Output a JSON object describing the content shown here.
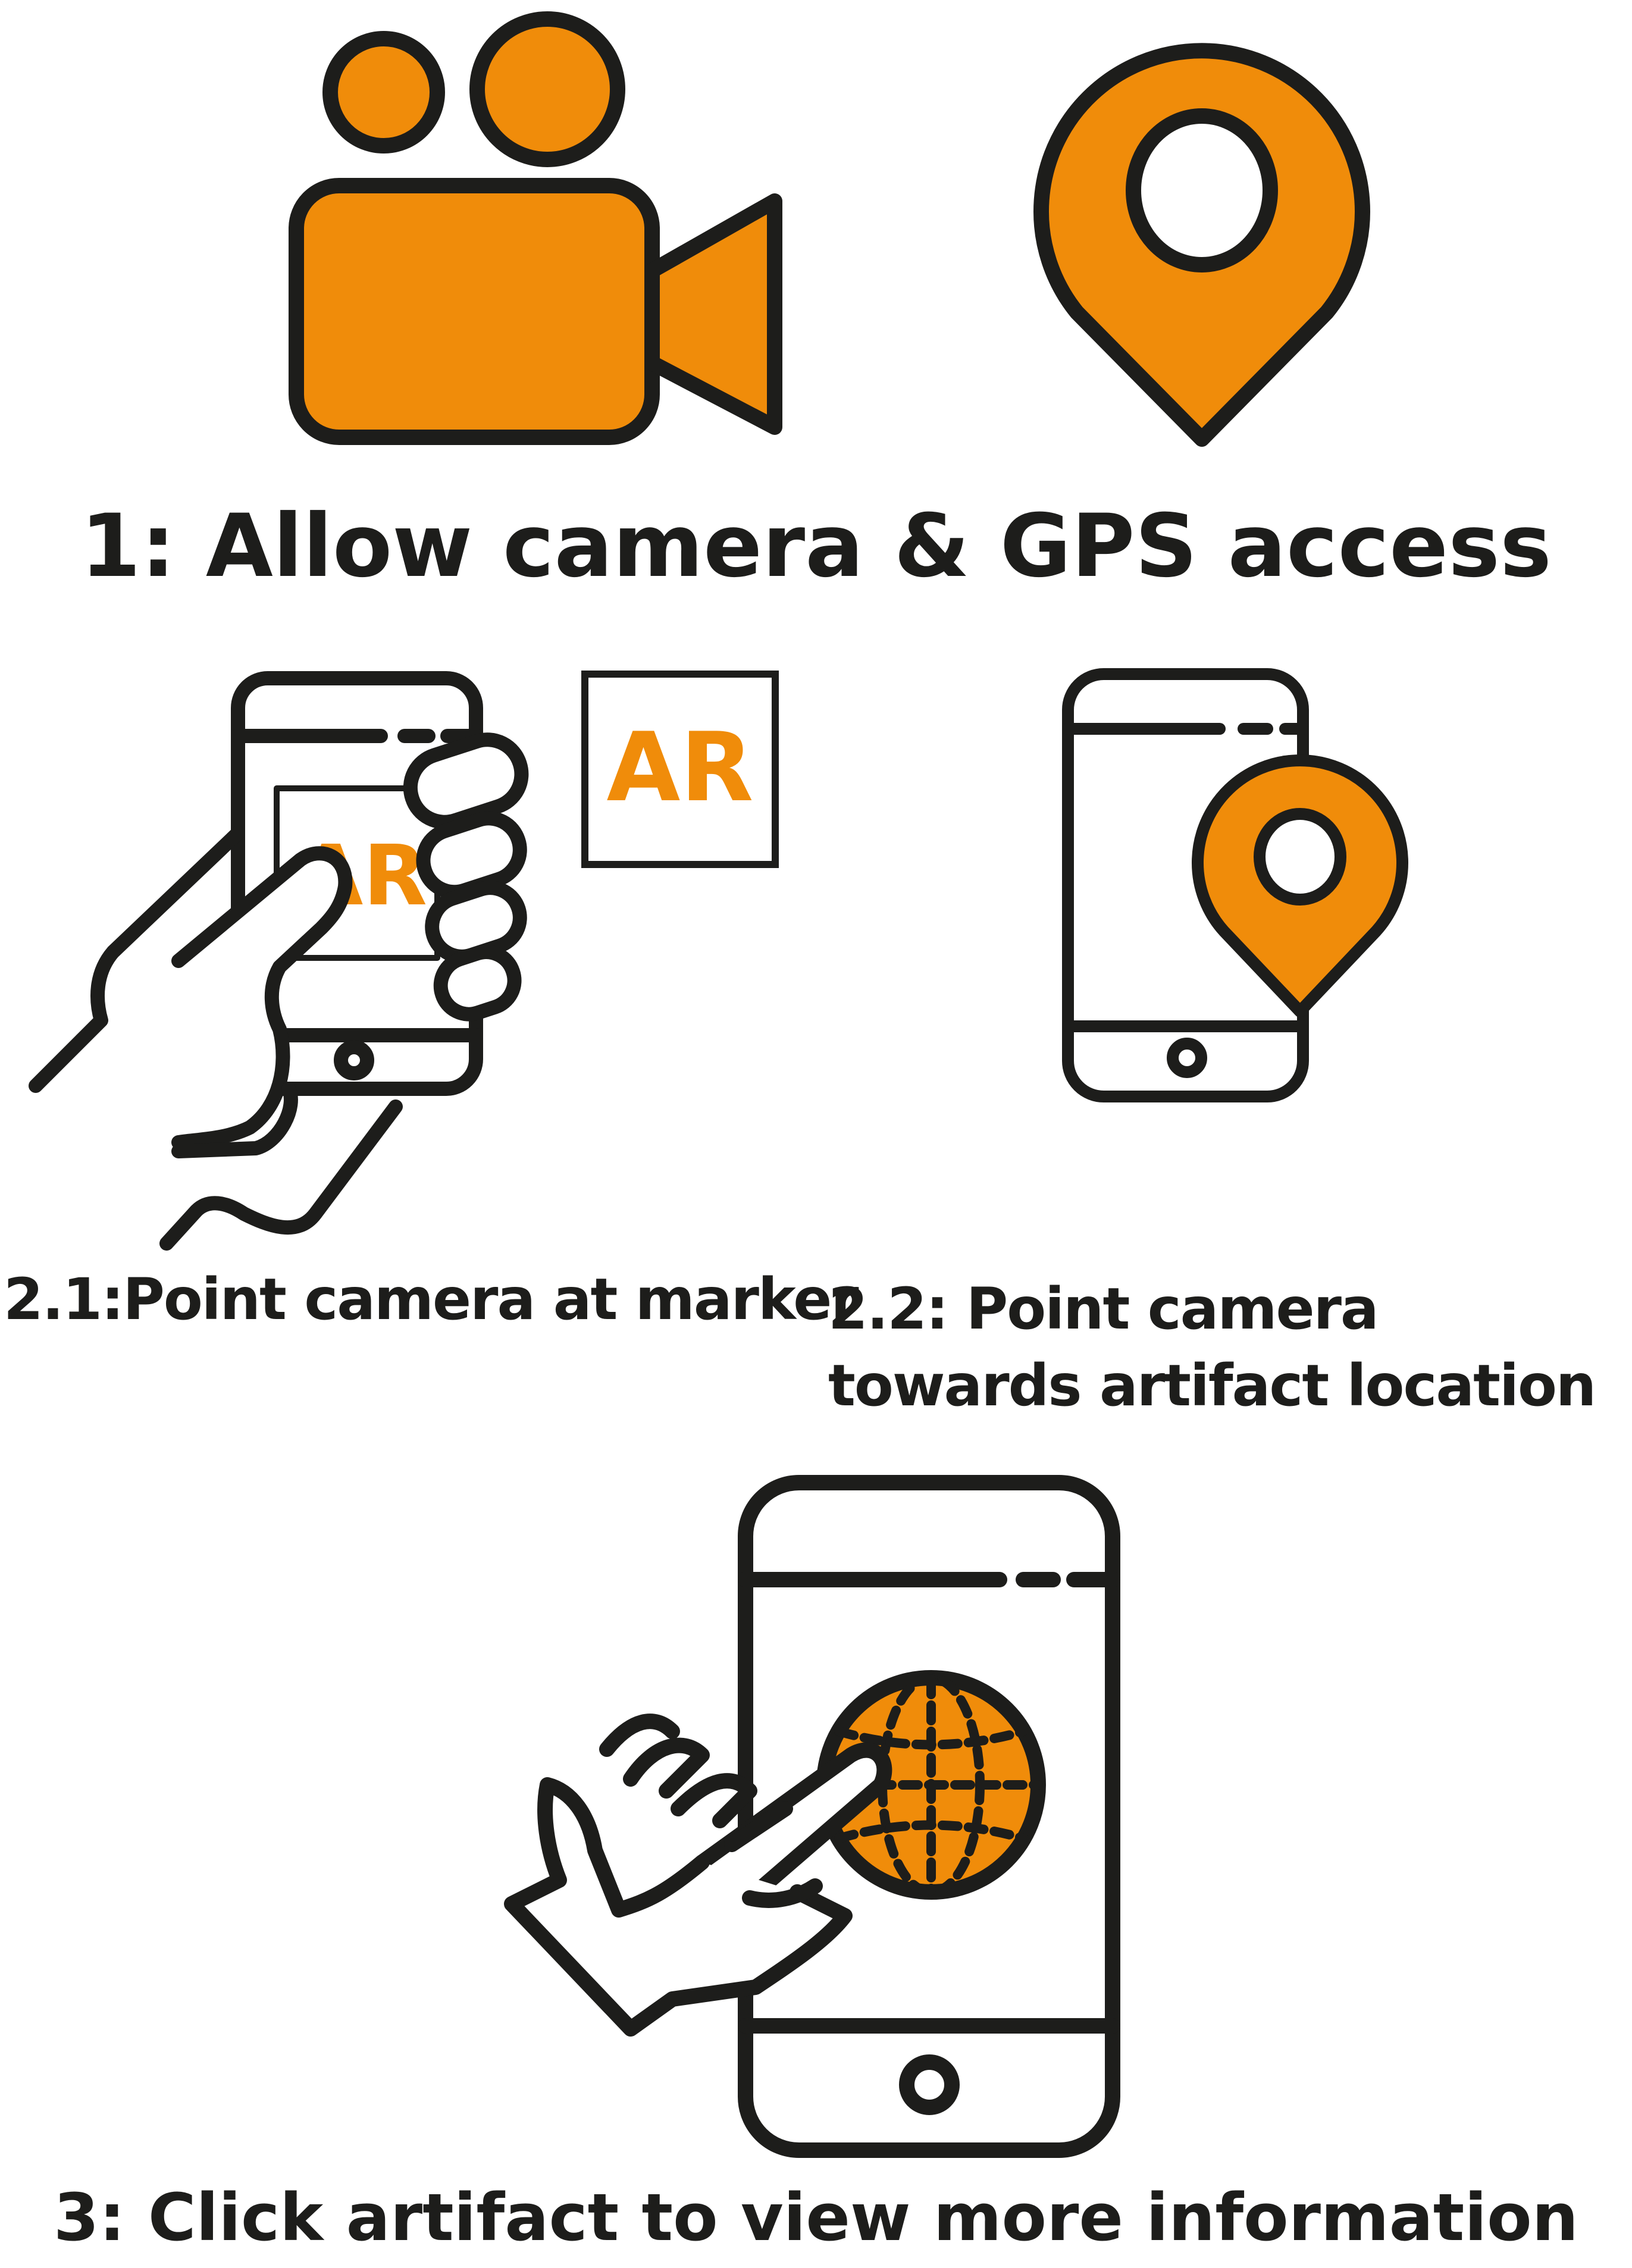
{
  "steps": {
    "step1": {
      "label": "1: Allow camera & GPS access",
      "icons": [
        "video-camera-icon",
        "location-pin-icon"
      ]
    },
    "step2_1": {
      "label": "2.1:Point camera at marker",
      "marker_text": "AR",
      "icons": [
        "hand-holding-phone-icon",
        "ar-marker-icon"
      ]
    },
    "step2_2": {
      "label": "2.2: Point camera towards artifact location",
      "icons": [
        "phone-with-location-pin-icon"
      ]
    },
    "step3": {
      "label": "3: Click artifact to view more information",
      "icons": [
        "hand-tapping-phone-icon",
        "globe-icon"
      ]
    }
  },
  "colors": {
    "accent": "#F08C0A",
    "stroke": "#1D1D1B",
    "background": "#FFFFFF"
  }
}
